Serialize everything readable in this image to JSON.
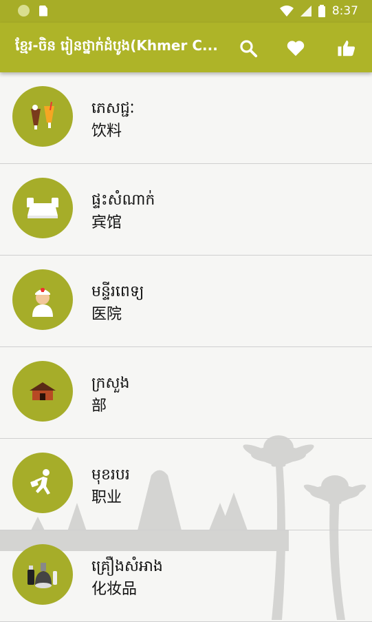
{
  "status_bar": {
    "time": "8:37",
    "icons": [
      "notification-dot-icon",
      "sim-card-icon",
      "wifi-icon",
      "signal-icon",
      "battery-icon"
    ]
  },
  "app_bar": {
    "title": "ខ្មែរ-ចិន រៀនថ្នាក់ដំបូង(Khmer C...",
    "actions": [
      "search-icon",
      "heart-icon",
      "thumbs-up-icon"
    ]
  },
  "categories": [
    {
      "khmer": "ភេសជ្ជៈ",
      "chinese": "饮料",
      "icon": "drinks-icon"
    },
    {
      "khmer": "ផ្ទះសំណាក់",
      "chinese": "宾馆",
      "icon": "bed-icon"
    },
    {
      "khmer": "មន្ទីរពេទ្យ",
      "chinese": "医院",
      "icon": "nurse-icon"
    },
    {
      "khmer": "ក្រសួង",
      "chinese": "部",
      "icon": "house-icon"
    },
    {
      "khmer": "មុខរបរ",
      "chinese": "职业",
      "icon": "running-worker-icon"
    },
    {
      "khmer": "គ្រឿងសំអាង",
      "chinese": "化妆品",
      "icon": "cosmetics-icon"
    }
  ],
  "colors": {
    "primary": "#aeb428",
    "status": "#a7ad27",
    "circle": "#a6ad29"
  }
}
